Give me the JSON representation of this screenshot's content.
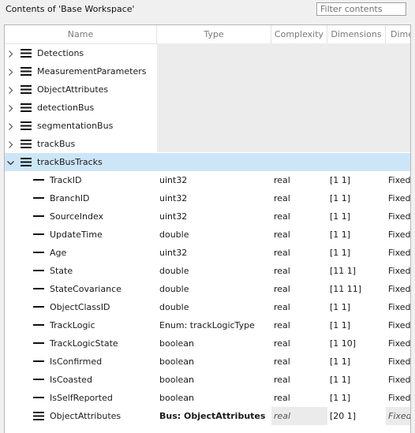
{
  "title": "Contents of 'Base Workspace'",
  "filter": {
    "placeholder": "Filter contents"
  },
  "columns": [
    "Name",
    "Type",
    "Complexity",
    "Dimensions",
    "Dime"
  ],
  "top_items": [
    {
      "name": "Detections",
      "expanded": false
    },
    {
      "name": "MeasurementParameters",
      "expanded": false
    },
    {
      "name": "ObjectAttributes",
      "expanded": false
    },
    {
      "name": "detectionBus",
      "expanded": false
    },
    {
      "name": "segmentationBus",
      "expanded": false
    },
    {
      "name": "trackBus",
      "expanded": false
    },
    {
      "name": "trackBusTracks",
      "expanded": true,
      "selected": true
    }
  ],
  "elements": [
    {
      "name": "TrackID",
      "type": "uint32",
      "complexity": "real",
      "dimensions": "[1 1]",
      "dims_mode": "Fixed"
    },
    {
      "name": "BranchID",
      "type": "uint32",
      "complexity": "real",
      "dimensions": "[1 1]",
      "dims_mode": "Fixed"
    },
    {
      "name": "SourceIndex",
      "type": "uint32",
      "complexity": "real",
      "dimensions": "[1 1]",
      "dims_mode": "Fixed"
    },
    {
      "name": "UpdateTime",
      "type": "double",
      "complexity": "real",
      "dimensions": "[1 1]",
      "dims_mode": "Fixed"
    },
    {
      "name": "Age",
      "type": "uint32",
      "complexity": "real",
      "dimensions": "[1 1]",
      "dims_mode": "Fixed"
    },
    {
      "name": "State",
      "type": "double",
      "complexity": "real",
      "dimensions": "[11 1]",
      "dims_mode": "Fixed"
    },
    {
      "name": "StateCovariance",
      "type": "double",
      "complexity": "real",
      "dimensions": "[11 11]",
      "dims_mode": "Fixed"
    },
    {
      "name": "ObjectClassID",
      "type": "double",
      "complexity": "real",
      "dimensions": "[1 1]",
      "dims_mode": "Fixed"
    },
    {
      "name": "TrackLogic",
      "type": "Enum: trackLogicType",
      "complexity": "real",
      "dimensions": "[1 1]",
      "dims_mode": "Fixed"
    },
    {
      "name": "TrackLogicState",
      "type": "boolean",
      "complexity": "real",
      "dimensions": "[1 10]",
      "dims_mode": "Fixed"
    },
    {
      "name": "IsConfirmed",
      "type": "boolean",
      "complexity": "real",
      "dimensions": "[1 1]",
      "dims_mode": "Fixed"
    },
    {
      "name": "IsCoasted",
      "type": "boolean",
      "complexity": "real",
      "dimensions": "[1 1]",
      "dims_mode": "Fixed"
    },
    {
      "name": "IsSelfReported",
      "type": "boolean",
      "complexity": "real",
      "dimensions": "[1 1]",
      "dims_mode": "Fixed"
    },
    {
      "name": "ObjectAttributes",
      "type": "Bus: ObjectAttributes",
      "complexity": "real",
      "dimensions": "[20 1]",
      "dims_mode": "Fixed",
      "is_bus": true
    }
  ],
  "icons": {
    "expand": "chevron-right-icon",
    "collapse": "chevron-down-icon",
    "bus": "bus-object-icon",
    "element": "bus-element-icon"
  }
}
